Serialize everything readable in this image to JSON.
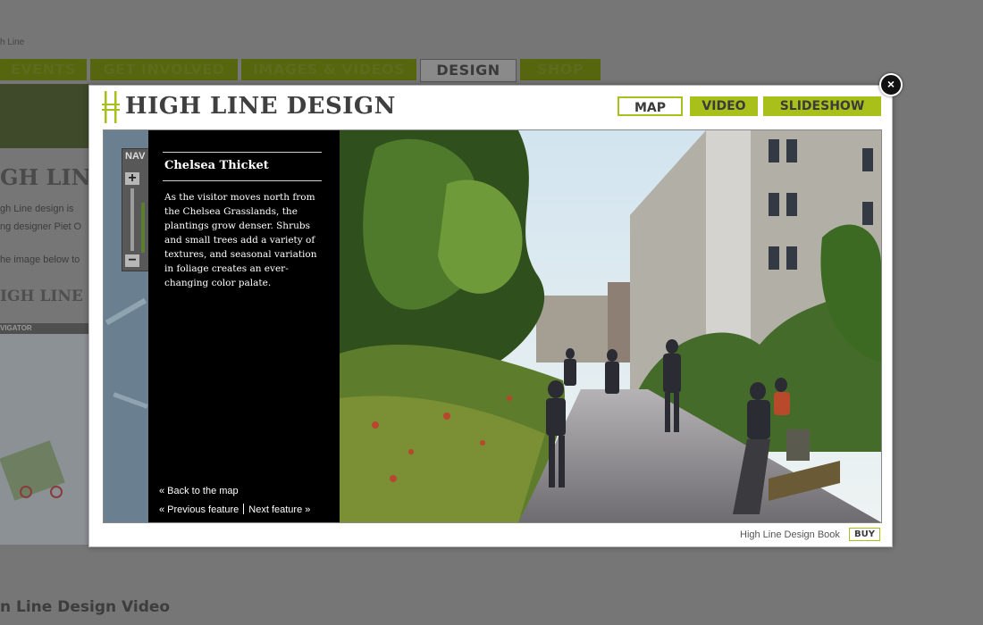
{
  "background": {
    "breadcrumb": "h Line",
    "nav": [
      {
        "label": "EVENTS",
        "active": false
      },
      {
        "label": "GET INVOLVED",
        "active": false
      },
      {
        "label": "IMAGES & VIDEOS",
        "active": false
      },
      {
        "label": "DESIGN",
        "active": true
      },
      {
        "label": "SHOP",
        "active": false
      }
    ],
    "heading": "GH LINE D",
    "text_lines": [
      "gh Line design is",
      "ng designer Piet O",
      "he image below to"
    ],
    "heading2": "IGH LINE D",
    "map_bar": "VIGATOR",
    "video_title": "n Line Design Video"
  },
  "modal": {
    "close_symbol": "×",
    "title": "HIGH LINE DESIGN",
    "tabs": {
      "map": "MAP",
      "video": "VIDEO",
      "slideshow": "SLIDESHOW"
    },
    "nav_widget": {
      "label": "NAV",
      "plus": "+",
      "minus": "−"
    },
    "feature": {
      "title": "Chelsea Thicket",
      "description": "As the visitor moves north from the Chelsea Grasslands, the plantings grow denser. Shrubs and small trees add a variety of textures, and seasonal variation in foliage creates an ever-changing color palate."
    },
    "links": {
      "back": "« Back to the map",
      "previous": "« Previous feature",
      "next": "Next feature »"
    },
    "footer": {
      "book_label": "High Line Design Book",
      "buy_label": "BUY"
    },
    "colors": {
      "accent": "#a9c01b",
      "title": "#3f3f3f"
    }
  }
}
